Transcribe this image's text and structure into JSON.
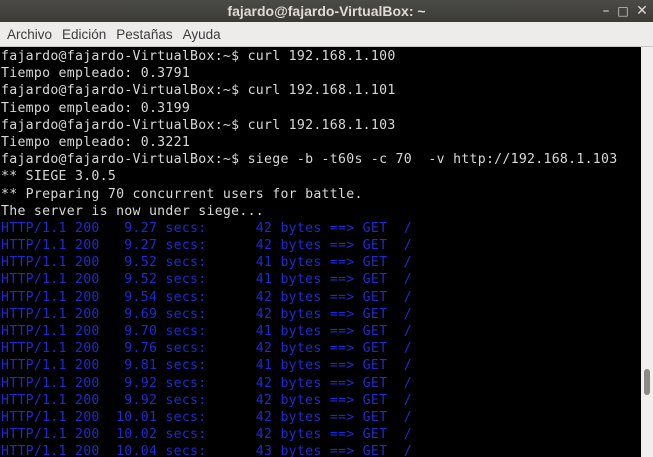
{
  "window": {
    "title": "fajardo@fajardo-VirtualBox: ~",
    "controls": {
      "minimize": "–",
      "maximize": "□",
      "close": "✕"
    }
  },
  "menu": [
    {
      "label": "Archivo"
    },
    {
      "label": "Edición"
    },
    {
      "label": "Pestañas"
    },
    {
      "label": "Ayuda"
    }
  ],
  "colors": {
    "terminal_background": "#000000",
    "terminal_text": "#d8d8d8",
    "siege_output": "#1d2bd3",
    "titlebar": "#3c3b37",
    "menubar": "#edecea"
  },
  "terminal": {
    "lines": [
      {
        "text": "fajardo@fajardo-VirtualBox:~$ curl 192.168.1.100",
        "style": "plain"
      },
      {
        "text": "Tiempo empleado: 0.3791",
        "style": "plain"
      },
      {
        "text": "fajardo@fajardo-VirtualBox:~$ curl 192.168.1.101",
        "style": "plain"
      },
      {
        "text": "Tiempo empleado: 0.3199",
        "style": "plain"
      },
      {
        "text": "fajardo@fajardo-VirtualBox:~$ curl 192.168.1.103",
        "style": "plain"
      },
      {
        "text": "Tiempo empleado: 0.3221",
        "style": "plain"
      },
      {
        "text": "fajardo@fajardo-VirtualBox:~$ siege -b -t60s -c 70  -v http://192.168.1.103",
        "style": "plain"
      },
      {
        "text": "** SIEGE 3.0.5",
        "style": "plain"
      },
      {
        "text": "** Preparing 70 concurrent users for battle.",
        "style": "plain"
      },
      {
        "text": "The server is now under siege...",
        "style": "plain"
      },
      {
        "text": "HTTP/1.1 200   9.27 secs:      42 bytes ==> GET  /",
        "style": "blue"
      },
      {
        "text": "HTTP/1.1 200   9.27 secs:      42 bytes ==> GET  /",
        "style": "blue"
      },
      {
        "text": "HTTP/1.1 200   9.52 secs:      41 bytes ==> GET  /",
        "style": "blue"
      },
      {
        "text": "HTTP/1.1 200   9.52 secs:      41 bytes ==> GET  /",
        "style": "blue"
      },
      {
        "text": "HTTP/1.1 200   9.54 secs:      42 bytes ==> GET  /",
        "style": "blue"
      },
      {
        "text": "HTTP/1.1 200   9.69 secs:      42 bytes ==> GET  /",
        "style": "blue"
      },
      {
        "text": "HTTP/1.1 200   9.70 secs:      41 bytes ==> GET  /",
        "style": "blue"
      },
      {
        "text": "HTTP/1.1 200   9.76 secs:      42 bytes ==> GET  /",
        "style": "blue"
      },
      {
        "text": "HTTP/1.1 200   9.81 secs:      41 bytes ==> GET  /",
        "style": "blue"
      },
      {
        "text": "HTTP/1.1 200   9.92 secs:      42 bytes ==> GET  /",
        "style": "blue"
      },
      {
        "text": "HTTP/1.1 200   9.92 secs:      42 bytes ==> GET  /",
        "style": "blue"
      },
      {
        "text": "HTTP/1.1 200  10.01 secs:      42 bytes ==> GET  /",
        "style": "blue"
      },
      {
        "text": "HTTP/1.1 200  10.02 secs:      42 bytes ==> GET  /",
        "style": "blue"
      },
      {
        "text": "HTTP/1.1 200  10.04 secs:      43 bytes ==> GET  /",
        "style": "blue"
      }
    ]
  }
}
